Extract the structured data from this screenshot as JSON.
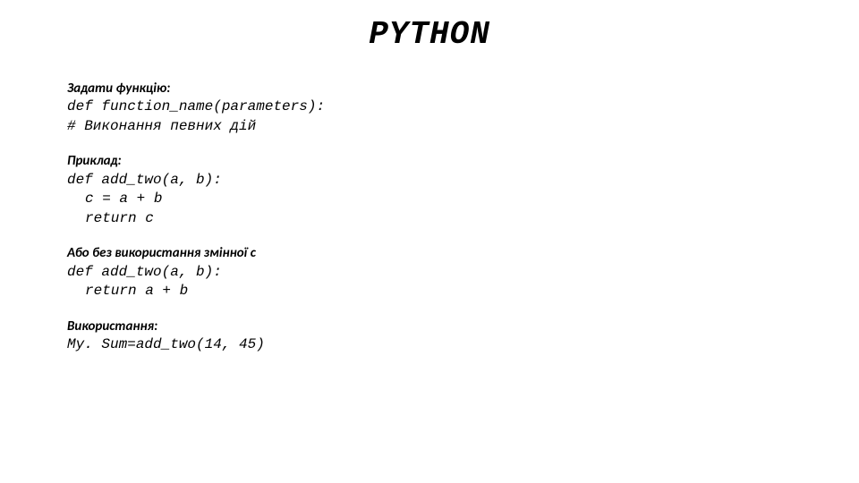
{
  "title": "PYTHON",
  "section1": {
    "label": "Задати функцію:",
    "line1": "def function_name(parameters):",
    "line2": "# Виконання певних дій"
  },
  "section2": {
    "label": "Приклад:",
    "line1": "def add_two(a, b):",
    "line2": "c = a + b",
    "line3": "return c"
  },
  "section3": {
    "label": "Або без використання змінної с",
    "line1": "def add_two(a, b):",
    "line2": "return a + b"
  },
  "section4": {
    "label": "Використання:",
    "line1": "My. Sum=add_two(14, 45)"
  }
}
